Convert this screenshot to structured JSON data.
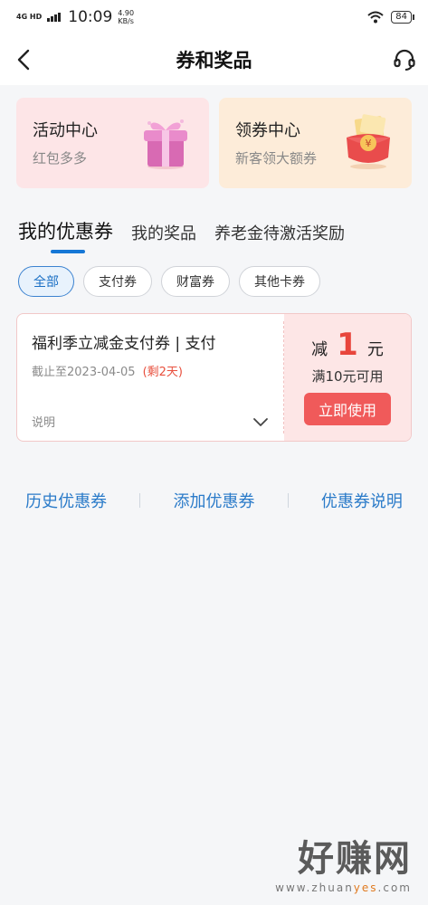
{
  "status_bar": {
    "network": "4G HD",
    "time": "10:09",
    "speed_value": "4.90",
    "speed_unit": "KB/s",
    "battery": "84"
  },
  "nav": {
    "title": "券和奖品",
    "back_icon": "chevron-left-icon",
    "service_icon": "headset-icon"
  },
  "promo_cards": [
    {
      "title": "活动中心",
      "subtitle": "红包多多",
      "icon": "gift-box-icon"
    },
    {
      "title": "领券中心",
      "subtitle": "新客领大额券",
      "icon": "red-envelope-icon"
    }
  ],
  "tabs": [
    {
      "label": "我的优惠券",
      "active": true
    },
    {
      "label": "我的奖品",
      "active": false
    },
    {
      "label": "养老金待激活奖励",
      "active": false
    }
  ],
  "filters": [
    {
      "label": "全部",
      "active": true
    },
    {
      "label": "支付券",
      "active": false
    },
    {
      "label": "财富券",
      "active": false
    },
    {
      "label": "其他卡券",
      "active": false
    }
  ],
  "coupon": {
    "title": "福利季立减金支付券 | 支付",
    "expiry": "截止至2023-04-05",
    "remaining": "(剩2天)",
    "desc_label": "说明",
    "amount_prefix": "减",
    "amount_value": "1",
    "amount_unit": "元",
    "threshold": "满10元可用",
    "use_button": "立即使用"
  },
  "footer_links": [
    "历史优惠券",
    "添加优惠券",
    "优惠券说明"
  ],
  "watermark": {
    "big": "好赚网",
    "small_prefix": "www.zhuan",
    "small_highlight": "yes",
    "small_suffix": ".com"
  },
  "colors": {
    "accent_blue": "#1677d6",
    "coupon_red": "#e8453c",
    "button_red": "#f05a5a"
  }
}
